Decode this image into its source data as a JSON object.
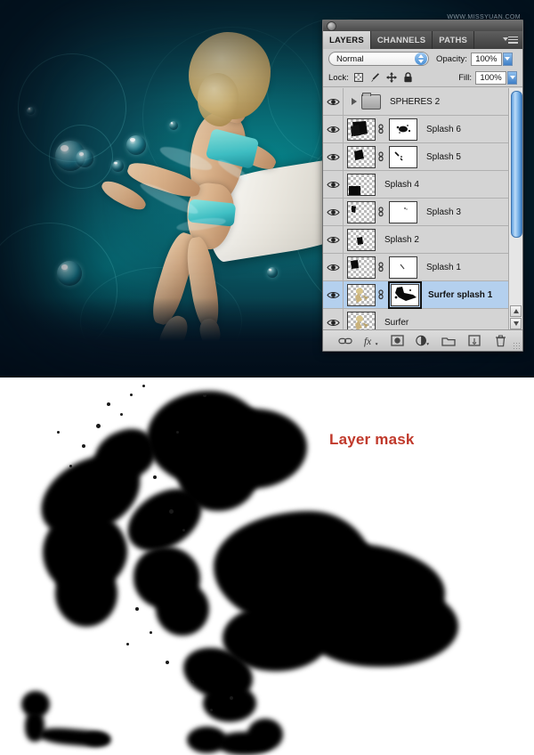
{
  "artwork": {
    "description": "surfer-girl-water-splash-composite",
    "watermark": "WWW.MISSYUAN.COM"
  },
  "panel": {
    "tabs": [
      {
        "label": "LAYERS",
        "active": true
      },
      {
        "label": "CHANNELS",
        "active": false
      },
      {
        "label": "PATHS",
        "active": false
      }
    ],
    "menu_icon": "panel-menu-icon",
    "blend_mode": "Normal",
    "opacity_label": "Opacity:",
    "opacity_value": "100%",
    "lock_label": "Lock:",
    "lock_icons": [
      "transparency-checkerboard-icon",
      "brush-icon",
      "move-icon",
      "lock-icon"
    ],
    "fill_label": "Fill:",
    "fill_value": "100%",
    "layers": [
      {
        "name": "SPHERES 2",
        "type": "group",
        "visible": true,
        "selected": false,
        "has_mask": false,
        "linked": false
      },
      {
        "name": "Splash 6",
        "type": "layer",
        "visible": true,
        "selected": false,
        "has_mask": true,
        "linked": true
      },
      {
        "name": "Splash 5",
        "type": "layer",
        "visible": true,
        "selected": false,
        "has_mask": true,
        "linked": true
      },
      {
        "name": "Splash 4",
        "type": "layer",
        "visible": true,
        "selected": false,
        "has_mask": false,
        "linked": false
      },
      {
        "name": "Splash 3",
        "type": "layer",
        "visible": true,
        "selected": false,
        "has_mask": true,
        "linked": true
      },
      {
        "name": "Splash 2",
        "type": "layer",
        "visible": true,
        "selected": false,
        "has_mask": false,
        "linked": false
      },
      {
        "name": "Splash 1",
        "type": "layer",
        "visible": true,
        "selected": false,
        "has_mask": true,
        "linked": true
      },
      {
        "name": "Surfer splash 1",
        "type": "layer",
        "visible": true,
        "selected": true,
        "has_mask": true,
        "linked": true
      },
      {
        "name": "Surfer",
        "type": "layer",
        "visible": true,
        "selected": false,
        "has_mask": false,
        "linked": false
      }
    ],
    "bottom_icons": [
      "link-layers-icon",
      "layer-styles-fx-icon",
      "add-layer-mask-icon",
      "adjustment-layer-icon",
      "new-group-icon",
      "new-layer-icon",
      "delete-layer-icon"
    ],
    "scrollbar": {
      "thumb_color": "#6aa8e4"
    }
  },
  "mask_section": {
    "label": "Layer mask",
    "label_color": "#c0392b"
  }
}
